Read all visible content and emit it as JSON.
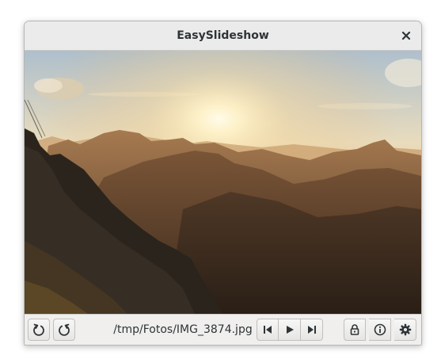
{
  "window": {
    "title": "EasySlideshow",
    "close_icon": "close-icon"
  },
  "toolbar": {
    "rotate_left_icon": "rotate-left-icon",
    "rotate_right_icon": "rotate-right-icon",
    "filename": "/tmp/Fotos/IMG_3874.jpg",
    "previous_icon": "skip-previous-icon",
    "play_icon": "play-icon",
    "next_icon": "skip-next-icon",
    "lock_icon": "lock-icon",
    "info_icon": "info-icon",
    "settings_icon": "gear-icon"
  },
  "colors": {
    "sky_top": "#b8c6d2",
    "sun": "#fff7dd",
    "mountains_dark": "#2a2017"
  }
}
